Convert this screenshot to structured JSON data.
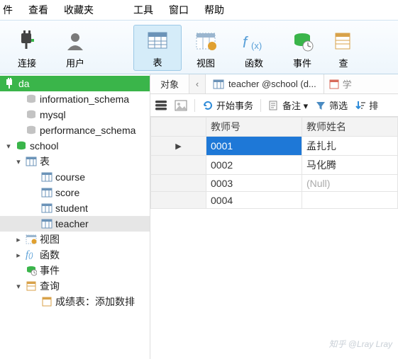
{
  "menu": {
    "file": "件",
    "view": "查看",
    "fav": "收藏夹",
    "tools": "工具",
    "window": "窗口",
    "help": "帮助"
  },
  "ribbon": {
    "connect": "连接",
    "user": "用户",
    "table": "表",
    "view": "视图",
    "function": "函数",
    "event": "事件",
    "query": "查"
  },
  "tree": {
    "root": "da",
    "db1": "information_schema",
    "db2": "mysql",
    "db3": "performance_schema",
    "db4": "school",
    "tables_label": "表",
    "tbl_course": "course",
    "tbl_score": "score",
    "tbl_student": "student",
    "tbl_teacher": "teacher",
    "views_label": "视图",
    "funcs_label": "函数",
    "events_label": "事件",
    "queries_label": "查询",
    "query1": "成绩表：添加数排"
  },
  "tabs": {
    "objects": "对象",
    "open_table": "teacher @school (d...",
    "extra": "学"
  },
  "toolbar": {
    "begin_tx": "开始事务",
    "memo": "备注 ▾",
    "filter": "筛选",
    "sort": "排"
  },
  "grid": {
    "col_id": "教师号",
    "col_name": "教师姓名",
    "rows": [
      {
        "id": "0001",
        "name": "孟扎扎"
      },
      {
        "id": "0002",
        "name": "马化腾"
      },
      {
        "id": "0003",
        "name": "(Null)"
      },
      {
        "id": "0004",
        "name": ""
      }
    ]
  },
  "watermark": "知乎 @Lray Lray"
}
